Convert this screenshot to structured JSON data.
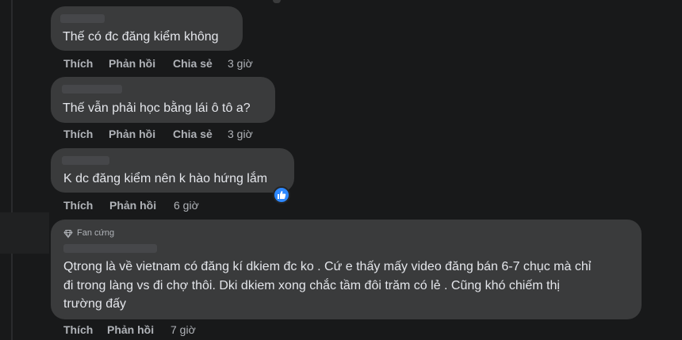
{
  "comments": [
    {
      "text": "Thế có đc đăng kiểm không",
      "actions": [
        "Thích",
        "Phản hồi",
        "Chia sẻ"
      ],
      "time": "3 giờ"
    },
    {
      "text": "Thế vẫn phải học bằng lái ô tô a?",
      "actions": [
        "Thích",
        "Phản hồi",
        "Chia sẻ"
      ],
      "time": "3 giờ"
    },
    {
      "text": "K dc đăng kiểm nên k hào hứng lắm",
      "actions": [
        "Thích",
        "Phản hồi"
      ],
      "time": "6 giờ",
      "reaction": "like"
    },
    {
      "badge": "Fan cứng",
      "lines": [
        "Qtrong là về vietnam có đăng kí dkiem đc ko . Cứ e thấy mấy video đăng bán 6-7 chục mà chỉ",
        "đi trong làng vs đi chợ thôi. Dki dkiem xong chắc tầm đôi trăm có lẻ . Cũng khó chiếm thị",
        "trường đấy"
      ],
      "actions": [
        "Thích",
        "Phản hồi"
      ],
      "time": "7 giờ"
    }
  ],
  "colors": {
    "background": "#18191a",
    "bubble": "#3a3b3c",
    "text": "#e4e6eb",
    "secondary": "#b0b3b8",
    "like": "#2d88ff"
  },
  "icons": {
    "badge": "diamond-icon",
    "reaction": "thumbs-up-icon"
  }
}
